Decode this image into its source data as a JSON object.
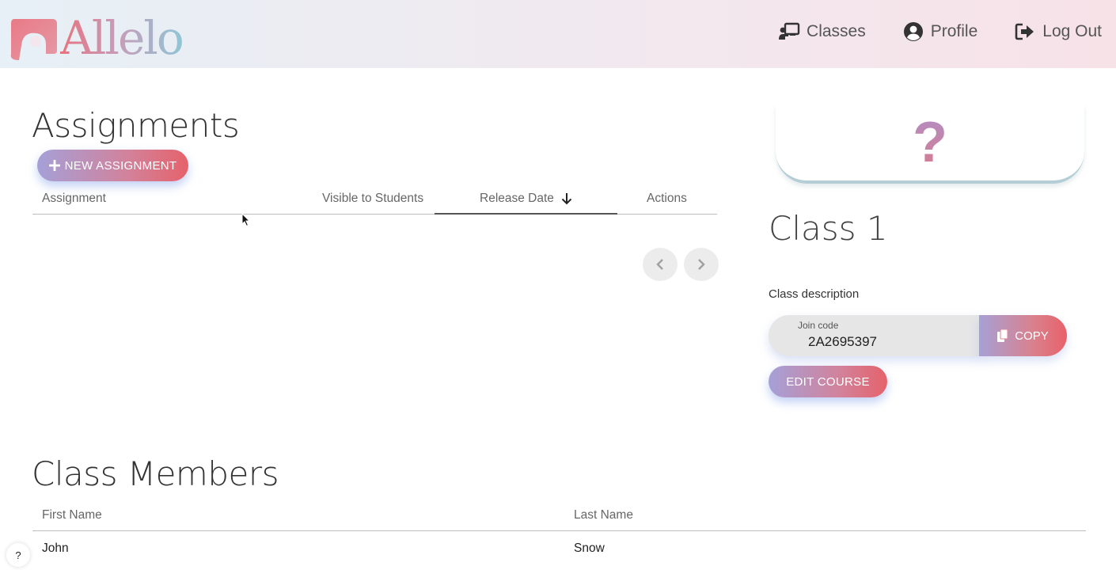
{
  "header": {
    "logo_text": "Allelo",
    "nav": [
      {
        "label": "Classes",
        "icon": "chalkboard-teacher-icon"
      },
      {
        "label": "Profile",
        "icon": "user-circle-icon"
      },
      {
        "label": "Log Out",
        "icon": "sign-out-icon"
      }
    ]
  },
  "assignments": {
    "title": "Assignments",
    "new_button": "NEW ASSIGNMENT",
    "columns": [
      "Assignment",
      "Visible to Students",
      "Release Date",
      "Actions"
    ],
    "sort_column": "Release Date",
    "sort_direction": "descending",
    "rows": []
  },
  "pagination": {
    "prev_icon": "chevron-left-icon",
    "next_icon": "chevron-right-icon"
  },
  "course": {
    "image_placeholder": "?",
    "name": "Class 1",
    "description": "Class description",
    "join_code_label": "Join code",
    "join_code": "2A2695397",
    "copy_label": "COPY",
    "edit_label": "EDIT COURSE"
  },
  "members": {
    "title": "Class Members",
    "columns": [
      "First Name",
      "Last Name"
    ],
    "rows": [
      {
        "first": "John",
        "last": "Snow"
      }
    ]
  },
  "help_button": "?",
  "colors": {
    "accent_start": "#a5a0d8",
    "accent_end": "#e5626b",
    "header_bg_start": "#e6f0f6",
    "header_bg_end": "#f7e2e8"
  }
}
